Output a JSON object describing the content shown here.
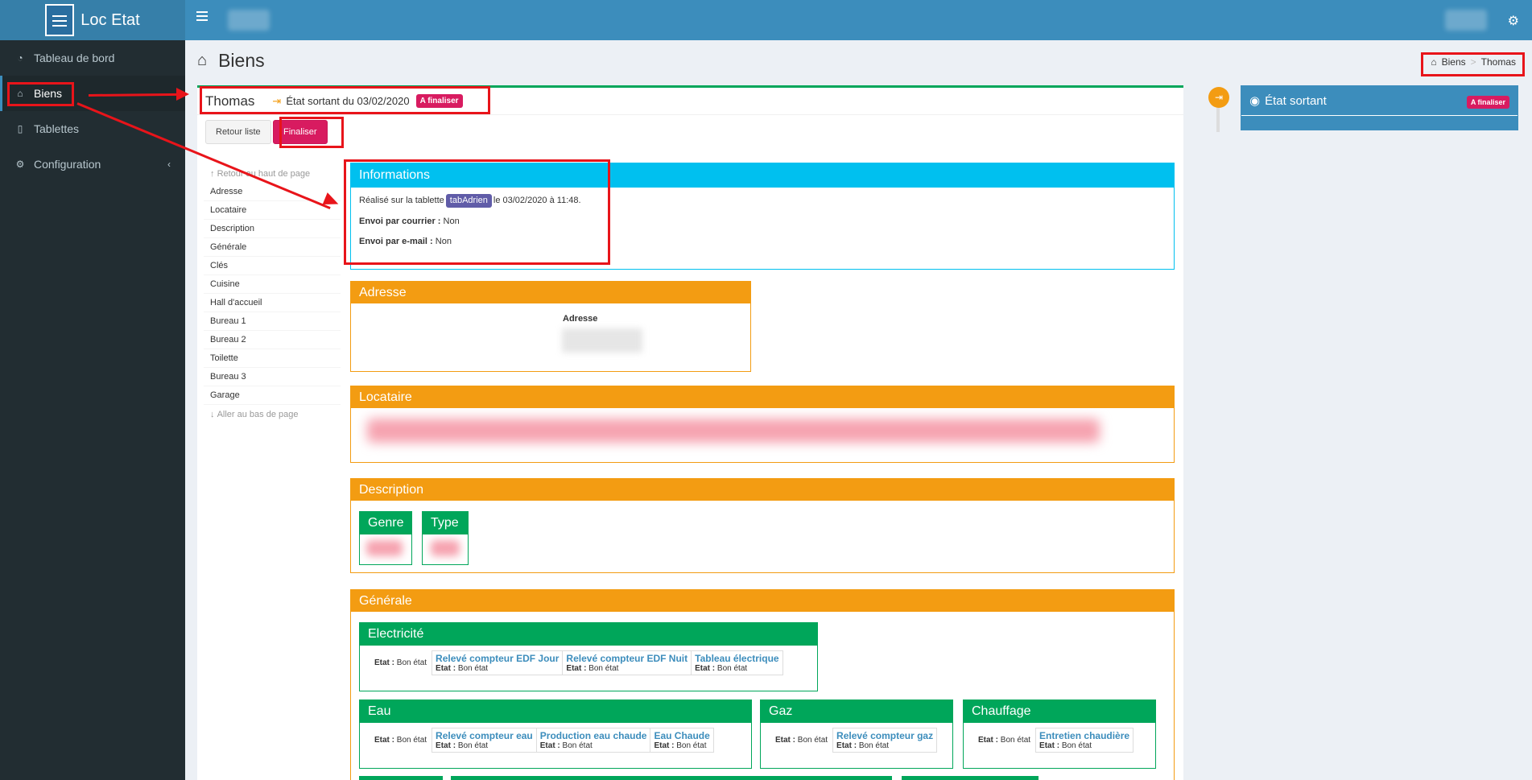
{
  "app": {
    "name": "Loc Etat"
  },
  "sidebar": {
    "items": [
      {
        "label": "Tableau de bord",
        "icon": "dashboard-icon"
      },
      {
        "label": "Biens",
        "icon": "home-icon"
      },
      {
        "label": "Tablettes",
        "icon": "tablet-icon"
      },
      {
        "label": "Configuration",
        "icon": "gears-icon"
      }
    ]
  },
  "page": {
    "title": "Biens",
    "breadcrumb": [
      "Biens",
      "Thomas"
    ]
  },
  "panel": {
    "owner": "Thomas",
    "etat_text": "État sortant du 03/02/2020",
    "status_badge": "A finaliser",
    "btn_back": "Retour liste",
    "btn_finalize": "Finaliser"
  },
  "toc": {
    "top": "Retour au haut de page",
    "items": [
      "Adresse",
      "Locataire",
      "Description",
      "Générale",
      "Clés",
      "Cuisine",
      "Hall d'accueil",
      "Bureau 1",
      "Bureau 2",
      "Toilette",
      "Bureau 3",
      "Garage"
    ],
    "bottom": "Aller au bas de page"
  },
  "informations": {
    "title": "Informations",
    "line_prefix": "Réalisé sur la tablette",
    "tablet": "tabAdrien",
    "line_suffix": "le 03/02/2020 à 11:48.",
    "courrier_label": "Envoi par courrier :",
    "courrier_value": "Non",
    "email_label": "Envoi par e-mail :",
    "email_value": "Non"
  },
  "adresse": {
    "title": "Adresse",
    "label": "Adresse"
  },
  "locataire": {
    "title": "Locataire"
  },
  "description": {
    "title": "Description",
    "genre": "Genre",
    "type": "Type"
  },
  "generale": {
    "title": "Générale",
    "etat_label": "Etat :",
    "etat_value": "Bon état",
    "electricite": {
      "title": "Electricité",
      "items": [
        "Relevé compteur EDF Jour",
        "Relevé compteur EDF Nuit",
        "Tableau électrique"
      ]
    },
    "eau": {
      "title": "Eau",
      "items": [
        "Relevé compteur eau",
        "Production eau chaude",
        "Eau Chaude"
      ]
    },
    "gaz": {
      "title": "Gaz",
      "items": [
        "Relevé compteur gaz"
      ]
    },
    "chauffage": {
      "title": "Chauffage",
      "items": [
        "Entretien chaudière"
      ]
    }
  },
  "timeline": {
    "title": "État sortant",
    "badge": "A finaliser"
  }
}
